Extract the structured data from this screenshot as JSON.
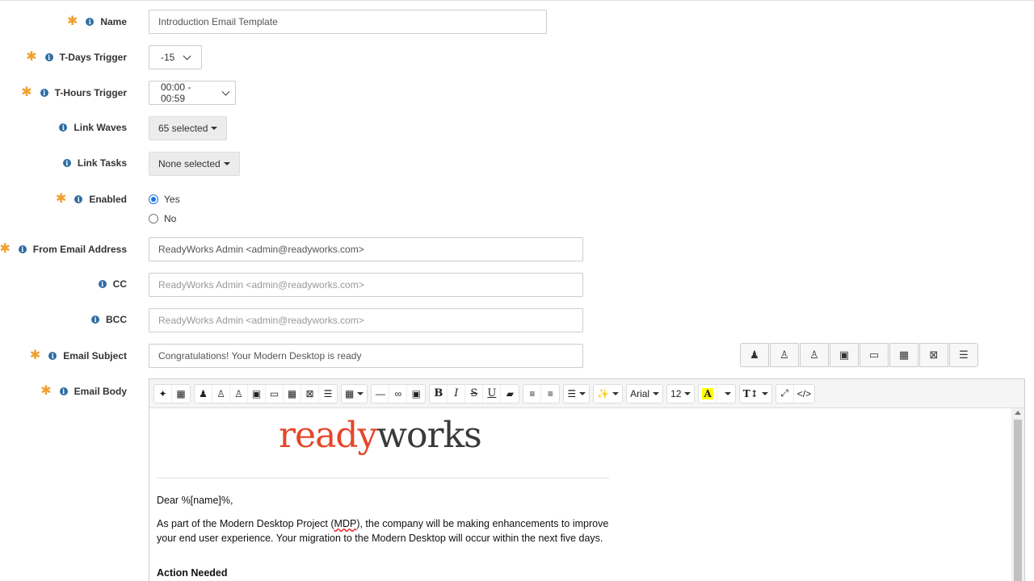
{
  "form": {
    "name": {
      "label": "Name",
      "value": "Introduction Email Template"
    },
    "t_days": {
      "label": "T-Days Trigger",
      "value": "-15"
    },
    "t_hours": {
      "label": "T-Hours Trigger",
      "value": "00:00 - 00:59"
    },
    "link_waves": {
      "label": "Link Waves",
      "value": "65 selected"
    },
    "link_tasks": {
      "label": "Link Tasks",
      "value": "None selected"
    },
    "enabled": {
      "label": "Enabled",
      "yes": "Yes",
      "no": "No",
      "selected": "Yes"
    },
    "from": {
      "label": "From Email Address",
      "value": "ReadyWorks Admin <admin@readyworks.com>"
    },
    "cc": {
      "label": "CC",
      "placeholder": "ReadyWorks Admin <admin@readyworks.com>"
    },
    "bcc": {
      "label": "BCC",
      "placeholder": "ReadyWorks Admin <admin@readyworks.com>"
    },
    "subject": {
      "label": "Email Subject",
      "value": "Congratulations! Your Modern Desktop is ready"
    },
    "body": {
      "label": "Email Body"
    }
  },
  "toolbar": {
    "font_name": "Arial",
    "font_size": "12"
  },
  "email": {
    "logo_ready": "ready",
    "logo_works": "works",
    "greeting": "Dear %[name]%,",
    "para_start": "As part of the Modern Desktop Project (",
    "para_abbr": "MDP",
    "para_end": "), the company will be making enhancements to improve your end user experience. Your migration to the Modern Desktop will occur within the next five days.",
    "heading": "Action Needed"
  },
  "colors": {
    "required": "#f0a030",
    "info": "#2e6da4",
    "logo_red": "#e5462b",
    "radio": "#1a73e8"
  }
}
